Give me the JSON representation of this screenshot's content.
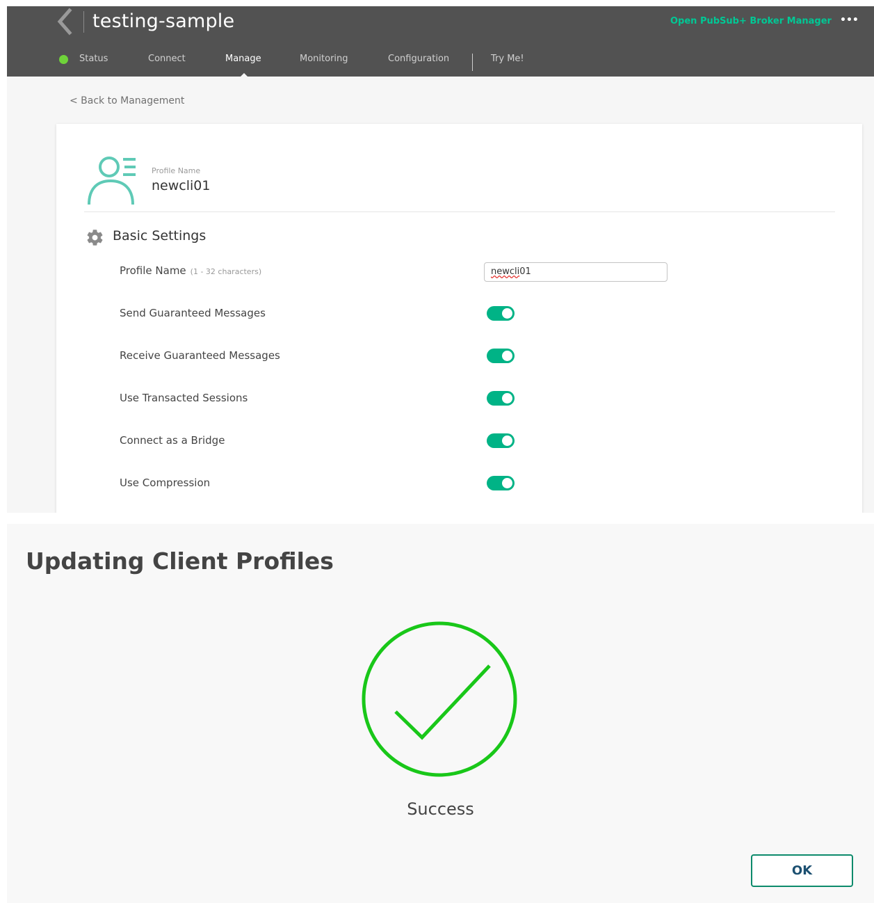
{
  "app": {
    "title": "testing-sample",
    "open_manager_label": "Open PubSub+ Broker Manager",
    "more_icon": "•••"
  },
  "nav": {
    "items": [
      {
        "label": "Status"
      },
      {
        "label": "Connect"
      },
      {
        "label": "Manage"
      },
      {
        "label": "Monitoring"
      },
      {
        "label": "Configuration"
      },
      {
        "label": "Try Me!"
      }
    ],
    "active": "Manage",
    "status_color": "#6fd33a"
  },
  "back_link": "< Back to Management",
  "profile": {
    "label": "Profile Name",
    "name": "newcli01"
  },
  "basic_settings": {
    "title": "Basic Settings",
    "profile_name_label": "Profile Name",
    "profile_name_hint": "(1 - 32 characters)",
    "profile_name_value_misspelled": "newcli",
    "profile_name_value_rest": "01",
    "toggles": [
      {
        "label": "Send Guaranteed Messages",
        "on": true
      },
      {
        "label": "Receive Guaranteed Messages",
        "on": true
      },
      {
        "label": "Use Transacted Sessions",
        "on": true
      },
      {
        "label": "Connect as a Bridge",
        "on": true
      },
      {
        "label": "Use Compression",
        "on": true
      }
    ]
  },
  "dialog": {
    "title": "Updating Client Profiles",
    "status": "Success",
    "ok_label": "OK"
  },
  "colors": {
    "accent": "#00b386",
    "link": "#00c895",
    "success": "#19c719",
    "header_bg": "#525252",
    "profile_icon": "#5fcab6"
  }
}
